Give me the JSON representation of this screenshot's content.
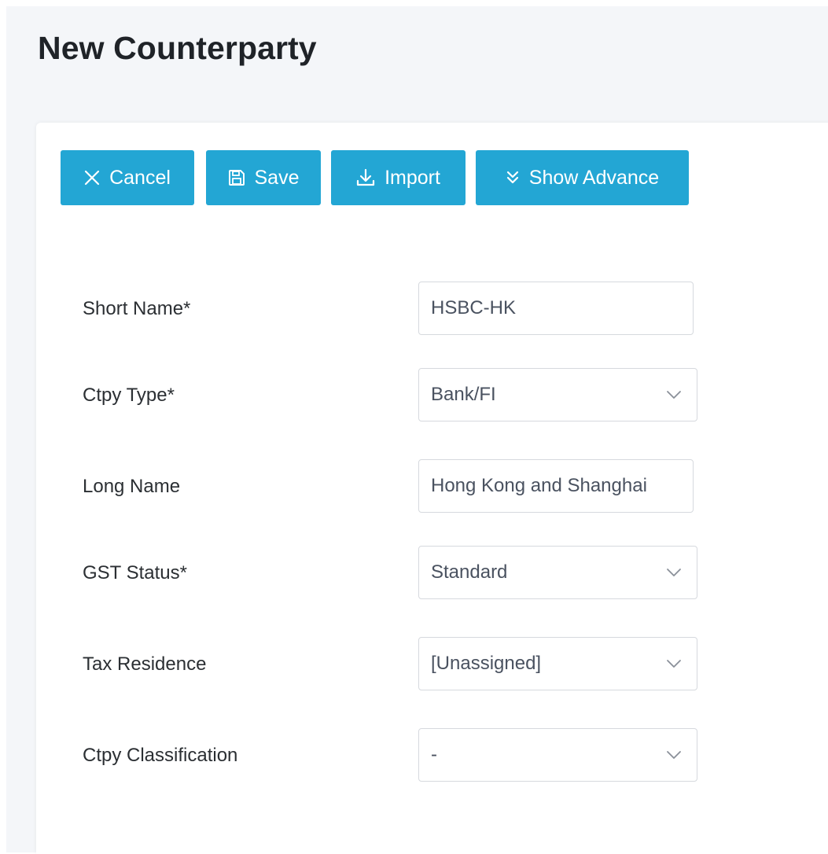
{
  "page": {
    "title": "New Counterparty"
  },
  "toolbar": {
    "cancel_label": "Cancel",
    "save_label": "Save",
    "import_label": "Import",
    "advance_label": "Show Advance",
    "button_color": "#23a6d4"
  },
  "form": {
    "short_name": {
      "label": "Short Name*",
      "value": "HSBC-HK"
    },
    "ctpy_type": {
      "label": "Ctpy Type*",
      "value": "Bank/FI"
    },
    "long_name": {
      "label": "Long Name",
      "value": "Hong Kong and Shanghai"
    },
    "gst_status": {
      "label": "GST Status*",
      "value": "Standard"
    },
    "tax_residence": {
      "label": "Tax Residence",
      "value": "[Unassigned]"
    },
    "ctpy_classification": {
      "label": "Ctpy Classification",
      "value": "-"
    }
  },
  "icons": {
    "cancel": "close-icon",
    "save": "floppy-disk-icon",
    "import": "download-icon",
    "advance": "chevrons-down-icon",
    "select": "chevron-down-icon"
  }
}
